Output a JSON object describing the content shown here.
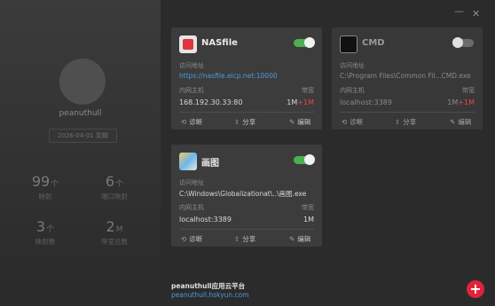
{
  "sidebar": {
    "username": "peanuthull",
    "expire_label": "2026-04-01 到期",
    "stats": [
      {
        "value": "99",
        "unit": "个",
        "label": "映射"
      },
      {
        "value": "6",
        "unit": "个",
        "label": "端口映射"
      },
      {
        "value": "3",
        "unit": "个",
        "label": "映射数"
      },
      {
        "value": "2",
        "unit": "M",
        "label": "带宽总数"
      }
    ]
  },
  "window_controls": {
    "minimize": "—",
    "close": "✕"
  },
  "cards": [
    {
      "name": "NASfile",
      "icon": "nasfile-icon",
      "enabled": true,
      "access_label": "访问地址",
      "access_value": "https://nasfile.eicp.net:10000",
      "host_label": "内网主机",
      "host_value": "168.192.30.33:80",
      "bw_label": "带宽",
      "bw_value": "1M",
      "bw_extra": "+1M",
      "actions": [
        "诊断",
        "分享",
        "编辑"
      ]
    },
    {
      "name": "CMD",
      "icon": "cmd-icon",
      "enabled": false,
      "access_label": "访问地址",
      "access_value": "C:\\Program Files\\Common Fil...CMD.exe",
      "host_label": "内网主机",
      "host_value": "localhost:3389",
      "bw_label": "带宽",
      "bw_value": "1M",
      "bw_extra": "+1M",
      "actions": [
        "诊断",
        "分享",
        "编辑"
      ]
    },
    {
      "name": "画图",
      "icon": "paint-icon",
      "enabled": true,
      "access_label": "访问地址",
      "access_value": "C:\\Windows\\Globalizationat\\..\\画图.exe",
      "host_label": "内网主机",
      "host_value": "localhost:3389",
      "bw_label": "带宽",
      "bw_value": "1M",
      "bw_extra": "",
      "actions": [
        "诊断",
        "分享",
        "编辑"
      ]
    }
  ],
  "footer": {
    "platform_name": "peanuthull应用云平台",
    "url": "peanuthull.hskyun.com",
    "add_label": "+"
  },
  "colors": {
    "accent": "#4caf50",
    "link": "#4a9be0",
    "danger": "#e0233c"
  }
}
